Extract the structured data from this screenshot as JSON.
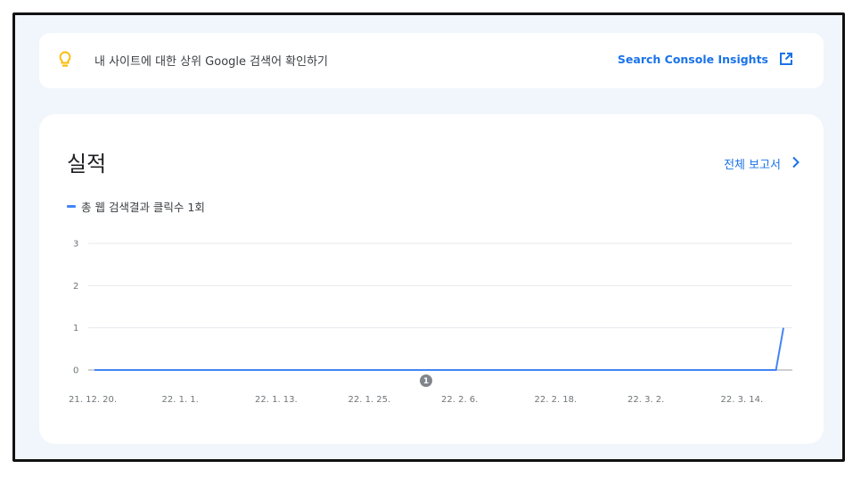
{
  "banner": {
    "text": "내 사이트에 대한 상위 Google 검색어 확인하기",
    "link_label": "Search Console Insights",
    "icons": [
      "lightbulb-icon",
      "open-in-new-icon"
    ],
    "bulb_color": "#fbbc04"
  },
  "card": {
    "title": "실적",
    "report_link": "전체 보고서",
    "legend_label": "총 웹 검색결과 클릭수 1회",
    "annotation": "1"
  },
  "chart_data": {
    "type": "line",
    "x": [
      "21. 12. 20.",
      "22. 1. 1.",
      "22. 1. 13.",
      "22. 1. 25.",
      "22. 2. 6.",
      "22. 2. 18.",
      "22. 3. 2.",
      "22. 3. 14."
    ],
    "y_ticks": [
      "0",
      "1",
      "2",
      "3"
    ],
    "ylim": [
      0,
      3
    ],
    "series": [
      {
        "color": "#4285f4",
        "points": [
          {
            "x": "2021-12-20",
            "y": 0
          },
          {
            "x": "2022-03-21",
            "y": 0
          },
          {
            "x": "2022-03-22",
            "y": 1
          }
        ]
      }
    ],
    "grid": true
  }
}
